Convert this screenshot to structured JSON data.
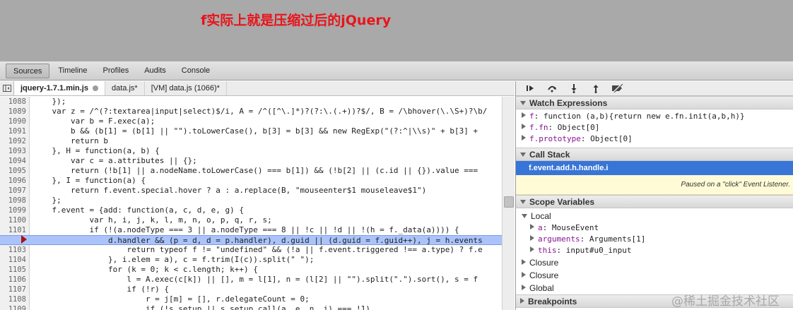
{
  "annotation": "f实际上就是压缩过后的jQuery",
  "main_tabs": [
    "Sources",
    "Timeline",
    "Profiles",
    "Audits",
    "Console"
  ],
  "file_tabs": [
    {
      "label": "jquery-1.7.1.min.js",
      "active": true
    },
    {
      "label": "data.js*",
      "active": false
    },
    {
      "label": "[VM] data.js (1066)*",
      "active": false
    }
  ],
  "code": {
    "execution_line": "1102",
    "lines": [
      {
        "n": "1088",
        "t": "    });"
      },
      {
        "n": "1089",
        "t": "    var z = /^(?:textarea|input|select)$/i, A = /^([^\\.]*)?(?:\\.(.+))?$/, B = /\\bhover(\\.\\S+)?\\b/"
      },
      {
        "n": "1090",
        "t": "        var b = F.exec(a);"
      },
      {
        "n": "1091",
        "t": "        b && (b[1] = (b[1] || \"\").toLowerCase(), b[3] = b[3] && new RegExp(\"(?:^|\\\\s)\" + b[3] +"
      },
      {
        "n": "1092",
        "t": "        return b"
      },
      {
        "n": "1093",
        "t": "    }, H = function(a, b) {"
      },
      {
        "n": "1094",
        "t": "        var c = a.attributes || {};"
      },
      {
        "n": "1095",
        "t": "        return (!b[1] || a.nodeName.toLowerCase() === b[1]) && (!b[2] || (c.id || {}).value ==="
      },
      {
        "n": "1096",
        "t": "    }, I = function(a) {"
      },
      {
        "n": "1097",
        "t": "        return f.event.special.hover ? a : a.replace(B, \"mouseenter$1 mouseleave$1\")"
      },
      {
        "n": "1098",
        "t": "    };"
      },
      {
        "n": "1099",
        "t": "    f.event = {add: function(a, c, d, e, g) {"
      },
      {
        "n": "1100",
        "t": "            var h, i, j, k, l, m, n, o, p, q, r, s;"
      },
      {
        "n": "1101",
        "t": "            if (!(a.nodeType === 3 || a.nodeType === 8 || !c || !d || !(h = f._data(a)))) {"
      },
      {
        "n": "",
        "t": "                d.handler && (p = d, d = p.handler), d.guid || (d.guid = f.guid++), j = h.events"
      },
      {
        "n": "1103",
        "t": "                    return typeof f != \"undefined\" && (!a || f.event.triggered !== a.type) ? f.e"
      },
      {
        "n": "1104",
        "t": "                }, i.elem = a), c = f.trim(I(c)).split(\" \");"
      },
      {
        "n": "1105",
        "t": "                for (k = 0; k < c.length; k++) {"
      },
      {
        "n": "1106",
        "t": "                    l = A.exec(c[k]) || [], m = l[1], n = (l[2] || \"\").split(\".\").sort(), s = f"
      },
      {
        "n": "1107",
        "t": "                    if (!r) {"
      },
      {
        "n": "1108",
        "t": "                        r = j[m] = [], r.delegateCount = 0;"
      },
      {
        "n": "1109",
        "t": "                        if (!s.setup || s.setup.call(a, e, n, i) === !1)"
      }
    ]
  },
  "sidebar": {
    "watch_title": "Watch Expressions",
    "watch": [
      {
        "name": "f",
        "value": "function (a,b){return new e.fn.init(a,b,h)}"
      },
      {
        "name": "f.fn",
        "value": "Object[0]"
      },
      {
        "name": "f.prototype",
        "value": "Object[0]"
      }
    ],
    "callstack_title": "Call Stack",
    "callstack_frame": "f.event.add.h.handle.i",
    "paused_message": "Paused on a \"click\" Event Listener.",
    "scope_title": "Scope Variables",
    "scope_local": "Local",
    "scope_vars": [
      {
        "name": "a",
        "value": "MouseEvent"
      },
      {
        "name": "arguments",
        "value": "Arguments[1]"
      },
      {
        "name": "this",
        "value": "input#u0_input"
      }
    ],
    "scope_others": [
      "Closure",
      "Closure",
      "Global"
    ],
    "breakpoints_title": "Breakpoints"
  },
  "watermark": "@稀土掘金技术社区"
}
